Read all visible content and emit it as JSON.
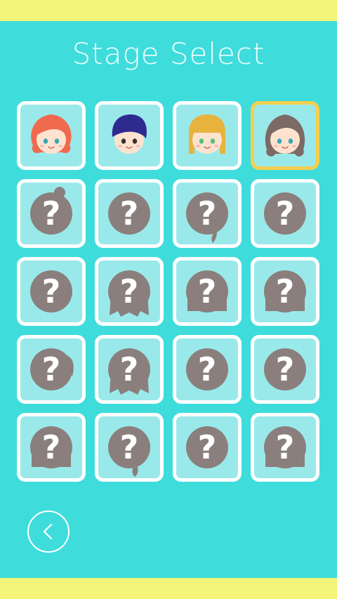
{
  "screen": {
    "title": "Stage Select"
  },
  "colors": {
    "background": "#3fdcdc",
    "bars": "#f2f57a",
    "tile_bg": "#9ae9ea",
    "tile_border": "#ffffff",
    "selected_border": "#f4cf4e",
    "locked_silhouette": "#8a7f7c"
  },
  "stages": [
    {
      "state": "unlocked",
      "icon": "red-hair-girl-face-icon",
      "hair": "#f06a4f",
      "eyes": "#3aa7b5"
    },
    {
      "state": "unlocked",
      "icon": "navy-hair-boy-face-icon",
      "hair": "#2e2b8f",
      "eyes": "#3a3230"
    },
    {
      "state": "unlocked",
      "icon": "blonde-bob-girl-face-icon",
      "hair": "#e8b33c",
      "eyes": "#5bbf7a"
    },
    {
      "state": "unlocked",
      "selected": true,
      "icon": "brown-wavy-hair-girl-face-icon",
      "hair": "#7c6a66",
      "eyes": "#3aa7b5"
    },
    {
      "state": "locked",
      "icon": "locked-bun-silhouette-icon",
      "symbol": "?"
    },
    {
      "state": "locked",
      "icon": "locked-curly-silhouette-icon",
      "symbol": "?"
    },
    {
      "state": "locked",
      "icon": "locked-ponytail-silhouette-icon",
      "symbol": "?"
    },
    {
      "state": "locked",
      "icon": "locked-curly-silhouette-icon",
      "symbol": "?"
    },
    {
      "state": "locked",
      "icon": "locked-short-silhouette-icon",
      "symbol": "?"
    },
    {
      "state": "locked",
      "icon": "locked-long-silhouette-icon",
      "symbol": "?"
    },
    {
      "state": "locked",
      "icon": "locked-bob-silhouette-icon",
      "symbol": "?"
    },
    {
      "state": "locked",
      "icon": "locked-bob-silhouette-icon",
      "symbol": "?"
    },
    {
      "state": "locked",
      "icon": "locked-sidetail-silhouette-icon",
      "symbol": "?"
    },
    {
      "state": "locked",
      "icon": "locked-long-silhouette-icon",
      "symbol": "?"
    },
    {
      "state": "locked",
      "icon": "locked-curly-silhouette-icon",
      "symbol": "?"
    },
    {
      "state": "locked",
      "icon": "locked-short-silhouette-icon",
      "symbol": "?"
    },
    {
      "state": "locked",
      "icon": "locked-bob-silhouette-icon",
      "symbol": "?"
    },
    {
      "state": "locked",
      "icon": "locked-braid-silhouette-icon",
      "symbol": "?"
    },
    {
      "state": "locked",
      "icon": "locked-short-silhouette-icon",
      "symbol": "?"
    },
    {
      "state": "locked",
      "icon": "locked-bob-silhouette-icon",
      "symbol": "?"
    }
  ],
  "back_button": {
    "icon": "chevron-left-icon"
  }
}
